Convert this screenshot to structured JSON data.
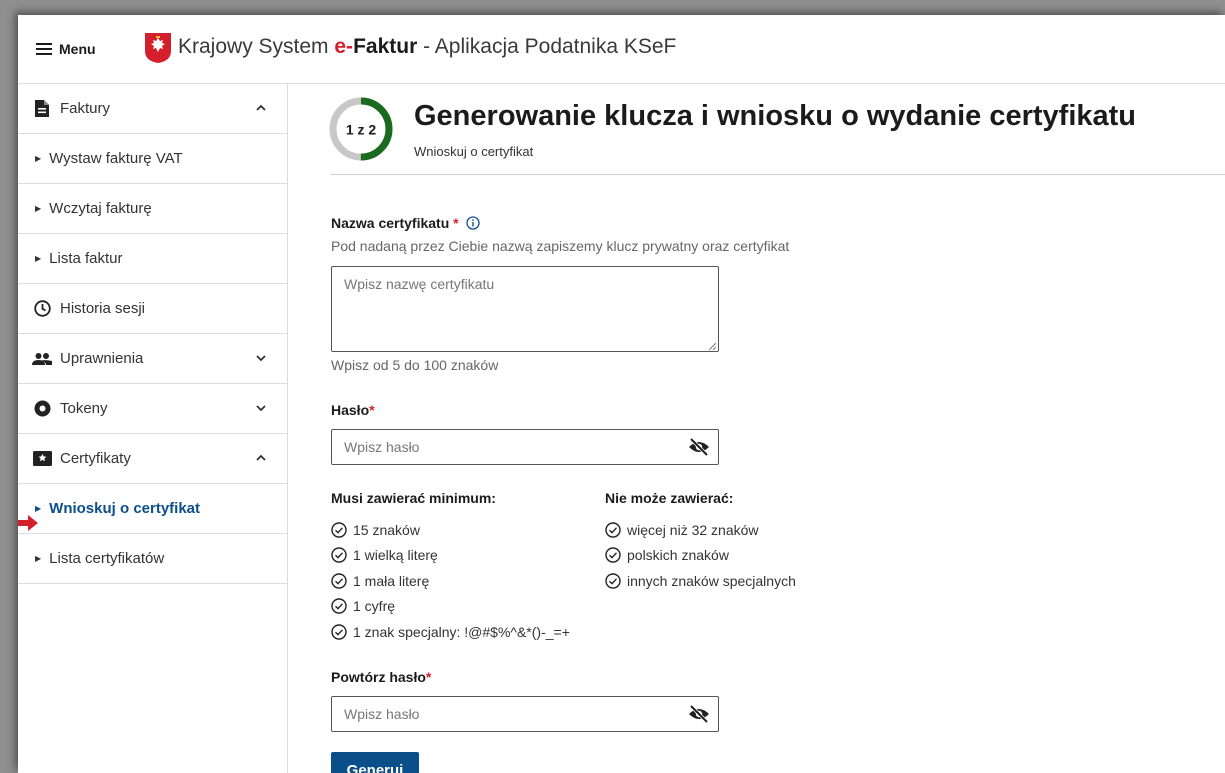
{
  "header": {
    "menu_label": "Menu",
    "title_pre": "Krajowy System ",
    "title_brand_e": "e-",
    "title_brand_f": "Faktur",
    "title_post": " - Aplikacja Podatnika KSeF"
  },
  "sidebar": {
    "items": [
      {
        "label": "Faktury",
        "icon": "document-icon",
        "expanded": true
      },
      {
        "label": "Wystaw fakturę VAT"
      },
      {
        "label": "Wczytaj fakturę"
      },
      {
        "label": "Lista faktur"
      },
      {
        "label": "Historia sesji",
        "icon": "clock-icon"
      },
      {
        "label": "Uprawnienia",
        "icon": "people-icon",
        "expanded": false
      },
      {
        "label": "Tokeny",
        "icon": "token-icon",
        "expanded": false
      },
      {
        "label": "Certyfikaty",
        "icon": "certificate-icon",
        "expanded": true
      },
      {
        "label": "Wnioskuj o certyfikat",
        "active": true
      },
      {
        "label": "Lista certyfikatów"
      }
    ]
  },
  "main": {
    "step_label": "1 z 2",
    "step_progress": 0.5,
    "title": "Generowanie klucza i wniosku o wydanie certyfikatu",
    "subtitle": "Wnioskuj o certyfikat",
    "cert_name": {
      "label": "Nazwa certyfikatu",
      "required_mark": "*",
      "hint": "Pod nadaną przez Ciebie nazwą zapiszemy klucz prywatny oraz certyfikat",
      "placeholder": "Wpisz nazwę certyfikatu",
      "value": "",
      "helper": "Wpisz od 5 do 100 znaków"
    },
    "password": {
      "label": "Hasło",
      "required_mark": "*",
      "placeholder": "Wpisz hasło",
      "value": ""
    },
    "must_contain": {
      "header": "Musi zawierać minimum:",
      "items": [
        "15 znaków",
        "1 wielką literę",
        "1 mała literę",
        "1 cyfrę",
        "1 znak specjalny: !@#$%^&*()-_=+"
      ]
    },
    "must_not_contain": {
      "header": "Nie może zawierać:",
      "items": [
        "więcej niż 32 znaków",
        "polskich znaków",
        "innych znaków specjalnych"
      ]
    },
    "repeat_password": {
      "label": "Powtórz hasło",
      "required_mark": "*",
      "placeholder": "Wpisz hasło",
      "value": ""
    },
    "generate_button": "Generuj"
  },
  "colors": {
    "brand_red": "#d4202c",
    "primary_blue": "#0b4f8a",
    "step_green": "#1a6b1f",
    "step_grey": "#c8c8c8"
  }
}
